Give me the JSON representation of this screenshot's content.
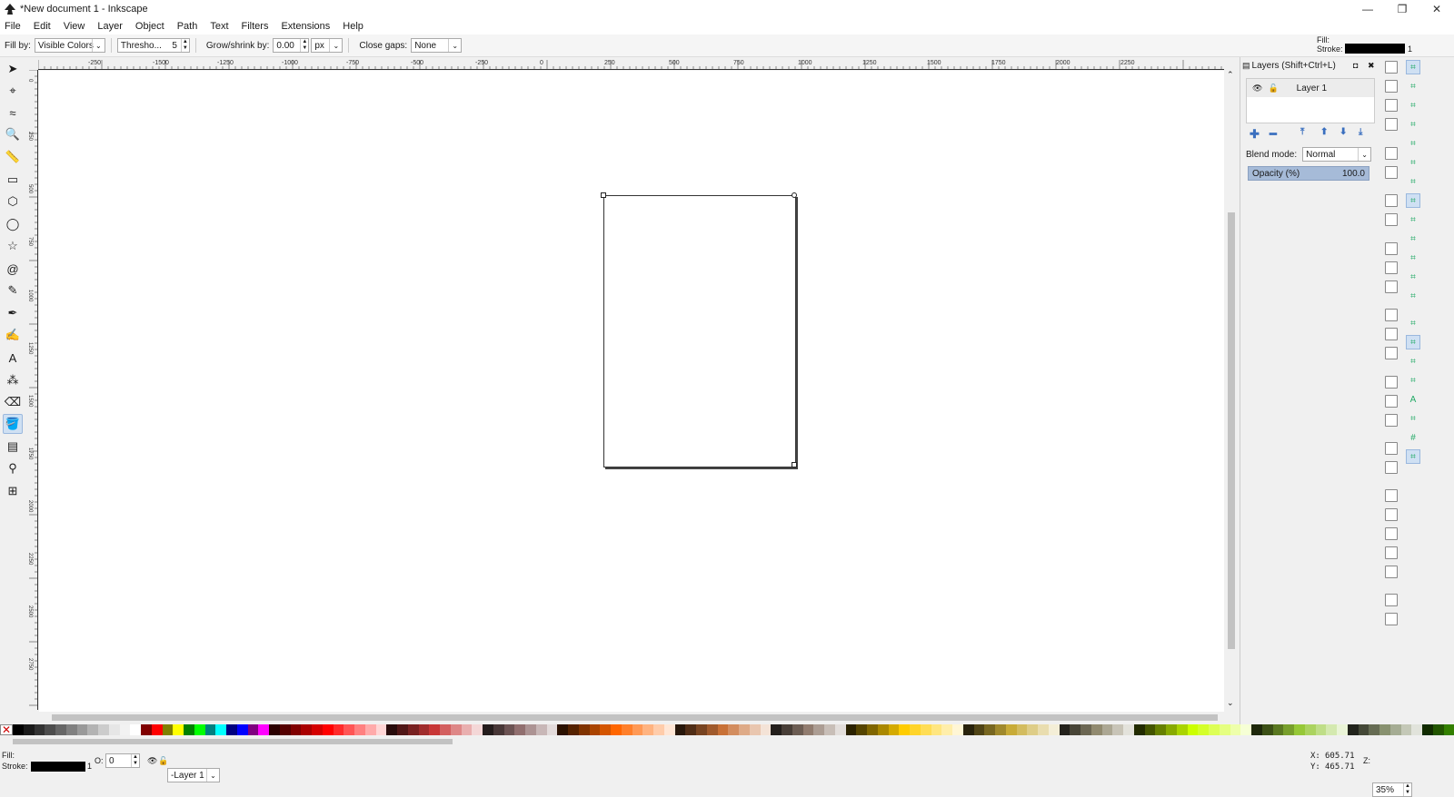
{
  "window": {
    "title": "*New document 1 - Inkscape",
    "minimize": "—",
    "restore": "❐",
    "close": "✕"
  },
  "menu": [
    "File",
    "Edit",
    "View",
    "Layer",
    "Object",
    "Path",
    "Text",
    "Filters",
    "Extensions",
    "Help"
  ],
  "tool_controls": {
    "fill_by_label": "Fill by:",
    "fill_by_value": "Visible Colors",
    "threshold_label": "Thresho...",
    "threshold_value": "5",
    "grow_label": "Grow/shrink by:",
    "grow_value": "0.00",
    "grow_unit": "px",
    "close_gaps_label": "Close gaps:",
    "close_gaps_value": "None"
  },
  "style_indicator": {
    "fill_label": "Fill:",
    "stroke_label": "Stroke:",
    "stroke_width": "1"
  },
  "ruler": {
    "top_labels": [
      "-250",
      "-1500",
      "-1250",
      "-1000",
      "-750",
      "-500",
      "-250",
      "0",
      "250",
      "500",
      "750",
      "1000",
      "1250",
      "1500",
      "1750",
      "2000",
      "2250"
    ],
    "left_labels": [
      "0",
      "250",
      "500",
      "750",
      "1000",
      "1250",
      "1500",
      "1750",
      "2000",
      "2250",
      "2500",
      "2750"
    ]
  },
  "tools": [
    {
      "name": "selector-tool",
      "glyph": "➤"
    },
    {
      "name": "node-tool",
      "glyph": "⌖"
    },
    {
      "name": "tweak-tool",
      "glyph": "≈"
    },
    {
      "name": "zoom-tool",
      "glyph": "🔍"
    },
    {
      "name": "measure-tool",
      "glyph": "📏"
    },
    {
      "name": "rectangle-tool",
      "glyph": "▭"
    },
    {
      "name": "3d-box-tool",
      "glyph": "⬡"
    },
    {
      "name": "ellipse-tool",
      "glyph": "◯"
    },
    {
      "name": "star-tool",
      "glyph": "☆"
    },
    {
      "name": "spiral-tool",
      "glyph": "@"
    },
    {
      "name": "pencil-tool",
      "glyph": "✎"
    },
    {
      "name": "pen-tool",
      "glyph": "✒"
    },
    {
      "name": "calligraphy-tool",
      "glyph": "✍"
    },
    {
      "name": "text-tool",
      "glyph": "A"
    },
    {
      "name": "spray-tool",
      "glyph": "⁂"
    },
    {
      "name": "eraser-tool",
      "glyph": "⌫"
    },
    {
      "name": "paint-bucket-tool",
      "glyph": "🪣"
    },
    {
      "name": "gradient-tool",
      "glyph": "▤"
    },
    {
      "name": "dropper-tool",
      "glyph": "⚲"
    },
    {
      "name": "connector-tool",
      "glyph": "⊞"
    }
  ],
  "layers_panel": {
    "title": "Layers (Shift+Ctrl+L)",
    "layer_name": "Layer 1",
    "blend_label": "Blend mode:",
    "blend_value": "Normal",
    "opacity_label": "Opacity (%)",
    "opacity_value": "100.0"
  },
  "palette_colors": [
    "#000000",
    "#1a1a1a",
    "#333333",
    "#4d4d4d",
    "#666666",
    "#808080",
    "#999999",
    "#b3b3b3",
    "#cccccc",
    "#e6e6e6",
    "#f2f2f2",
    "#ffffff",
    "#800000",
    "#ff0000",
    "#808000",
    "#ffff00",
    "#008000",
    "#00ff00",
    "#008080",
    "#00ffff",
    "#000080",
    "#0000ff",
    "#800080",
    "#ff00ff",
    "#2b0000",
    "#550000",
    "#800000",
    "#aa0000",
    "#d40000",
    "#ff0000",
    "#ff2a2a",
    "#ff5555",
    "#ff8080",
    "#ffaaaa",
    "#ffd5d5",
    "#280b0b",
    "#501616",
    "#782121",
    "#a02c2c",
    "#c83737",
    "#d35f5f",
    "#de8787",
    "#e9afaf",
    "#f4d7d7",
    "#241c1c",
    "#483737",
    "#6c5353",
    "#916f6f",
    "#ac9393",
    "#c8b7b7",
    "#e3dbdb",
    "#2b1100",
    "#552200",
    "#803300",
    "#aa4400",
    "#d45500",
    "#ff6600",
    "#ff7f2a",
    "#ff9955",
    "#ffb380",
    "#ffccaa",
    "#ffe6d5",
    "#28170b",
    "#502d16",
    "#784421",
    "#a05a2c",
    "#c87137",
    "#d38d5f",
    "#deaa87",
    "#e9c6af",
    "#f4e3d7",
    "#241f1c",
    "#483e37",
    "#6c5d53",
    "#917c6f",
    "#ac9d93",
    "#c8beb7",
    "#e3dedb",
    "#2b2200",
    "#554400",
    "#806600",
    "#aa8800",
    "#d4aa00",
    "#ffcc00",
    "#ffd42a",
    "#ffdd55",
    "#ffe680",
    "#ffeeaa",
    "#fff6d5",
    "#28220b",
    "#504416",
    "#786721",
    "#a0892c",
    "#c8ab37",
    "#d3bc5f",
    "#decd87",
    "#e9ddaf",
    "#f4eed7",
    "#24221c",
    "#484537",
    "#6c6753",
    "#918a6f",
    "#aca793",
    "#c8c4b7",
    "#e3e2db",
    "#222b00",
    "#445500",
    "#668000",
    "#88aa00",
    "#aad400",
    "#ccff00",
    "#d4ff2a",
    "#ddff55",
    "#e5ff80",
    "#eeffaa",
    "#f6ffd5",
    "#1e280b",
    "#3c5016",
    "#5a7821",
    "#789f2c",
    "#96c837",
    "#abd35f",
    "#bfde87",
    "#d4e9af",
    "#eaf4d7",
    "#22241c",
    "#444837",
    "#666c53",
    "#88916f",
    "#a5ac93",
    "#c4c8b7",
    "#e1e3db",
    "#112b00",
    "#225500",
    "#338000"
  ],
  "status": {
    "fill_label": "Fill:",
    "stroke_label": "Stroke:",
    "stroke_width": "1",
    "opacity_label": "O:",
    "opacity_value": "0",
    "layer_value": "-Layer 1",
    "x_label": "X:",
    "x_value": "605.71",
    "y_label": "Y:",
    "y_value": "465.71",
    "zoom_label": "Z:",
    "zoom_value": "35%"
  }
}
